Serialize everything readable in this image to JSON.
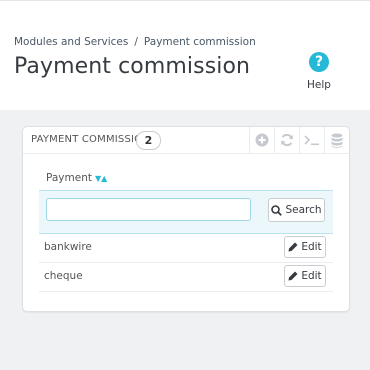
{
  "breadcrumb": {
    "parent": "Modules and Services",
    "separator": "/",
    "current": "Payment commission"
  },
  "page": {
    "title": "Payment commission"
  },
  "toolbar": {
    "help_label": "Help",
    "help_icon": "question-circle-icon"
  },
  "panel": {
    "title": "PAYMENT COMMISSION",
    "count": "2",
    "tools": [
      "add-new-icon",
      "refresh-icon",
      "sql-query-icon",
      "export-database-icon"
    ]
  },
  "table": {
    "columns": [
      "Payment"
    ],
    "sort": {
      "down": "▼",
      "up": "▲"
    },
    "filter": {
      "value": "",
      "search_label": "Search"
    },
    "rows": [
      {
        "payment": "bankwire",
        "action": "Edit"
      },
      {
        "payment": "cheque",
        "action": "Edit"
      }
    ]
  },
  "colors": {
    "accent": "#25b9d7",
    "background": "#eff1f2"
  }
}
